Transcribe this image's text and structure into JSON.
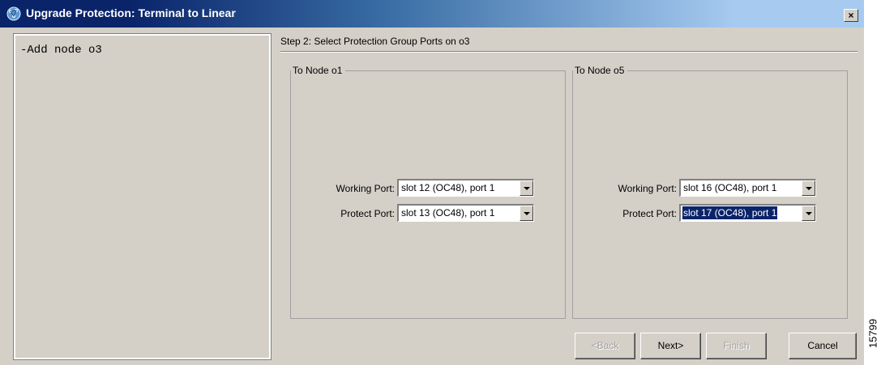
{
  "window": {
    "title": "Upgrade Protection: Terminal to Linear",
    "close_label": "×",
    "title_gradient": [
      "#0a246a",
      "#a6caf0"
    ]
  },
  "left_pane": {
    "steps": [
      "-Add node o3"
    ]
  },
  "step": {
    "title": "Step 2: Select Protection Group Ports on o3"
  },
  "groups": [
    {
      "legend": "To Node o1",
      "working_label": "Working Port:",
      "working_value": "slot 12 (OC48), port 1",
      "protect_label": "Protect Port:",
      "protect_value": "slot 13 (OC48), port 1"
    },
    {
      "legend": "To Node o5",
      "working_label": "Working Port:",
      "working_value": "slot 16 (OC48), port 1",
      "protect_label": "Protect Port:",
      "protect_value": "slot 17 (OC48), port 1"
    }
  ],
  "buttons": {
    "back": "<Back",
    "next": "Next>",
    "finish": "Finish",
    "cancel": "Cancel"
  },
  "figure_number": "15799",
  "colors": {
    "dialog_bg": "#d4d0c8",
    "selection": "#0a246a"
  },
  "icons": {
    "app": "network-globe-icon",
    "close": "close-icon",
    "dropdown": "chevron-down-icon"
  }
}
